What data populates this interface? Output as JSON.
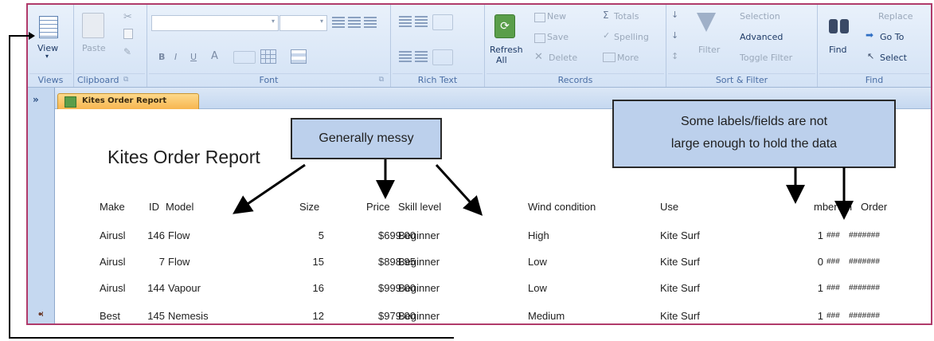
{
  "ribbon": {
    "views": {
      "view_label": "View",
      "view_arrow": "▾",
      "group": "Views"
    },
    "clipboard": {
      "paste": "Paste",
      "group": "Clipboard"
    },
    "font": {
      "bold": "B",
      "italic": "I",
      "underline": "U",
      "font_color": "A",
      "group": "Font"
    },
    "rich_text": {
      "group": "Rich Text"
    },
    "records": {
      "refresh": "Refresh",
      "refresh_all": "All",
      "new": "New",
      "save": "Save",
      "delete": "Delete",
      "totals": "Totals",
      "spelling": "Spelling",
      "more": "More",
      "group": "Records"
    },
    "sort_filter": {
      "filter": "Filter",
      "selection": "Selection",
      "advanced": "Advanced",
      "toggle_filter": "Toggle Filter",
      "group": "Sort & Filter"
    },
    "find": {
      "find": "Find",
      "replace": "Replace",
      "go_to": "Go To",
      "select": "Select",
      "group": "Find"
    }
  },
  "nav": {
    "collapse": "»"
  },
  "document_tab": {
    "label": "Kites Order Report"
  },
  "report": {
    "title": "Kites Order Report",
    "columns": [
      "Make",
      "ID",
      "Model",
      "Size",
      "Price",
      "Skill level",
      "Wind condition",
      "Use",
      "mber",
      "em",
      "Order"
    ],
    "rows": [
      [
        "Airusl",
        "146",
        "Flow",
        "5",
        "$699.00",
        "Beginner",
        "High",
        "Kite Surf",
        "1",
        "###",
        "#######"
      ],
      [
        "Airusl",
        "7",
        "Flow",
        "15",
        "$898.95",
        "Beginner",
        "Low",
        "Kite Surf",
        "0",
        "###",
        "#######"
      ],
      [
        "Airusl",
        "144",
        "Vapour",
        "16",
        "$999.00",
        "Beginner",
        "Low",
        "Kite Surf",
        "1",
        "###",
        "#######"
      ],
      [
        "Best",
        "145",
        "Nemesis",
        "12",
        "$979.00",
        "Beginner",
        "Medium",
        "Kite Surf",
        "1",
        "###",
        "#######"
      ]
    ]
  },
  "callouts": {
    "messy": "Generally messy",
    "labels_line1": "Some labels/fields are not",
    "labels_line2": "large enough to hold the data"
  },
  "colors": {
    "frame": "#b03a6a",
    "callout_bg": "#bcd0ec",
    "tab": "#f7b650"
  }
}
